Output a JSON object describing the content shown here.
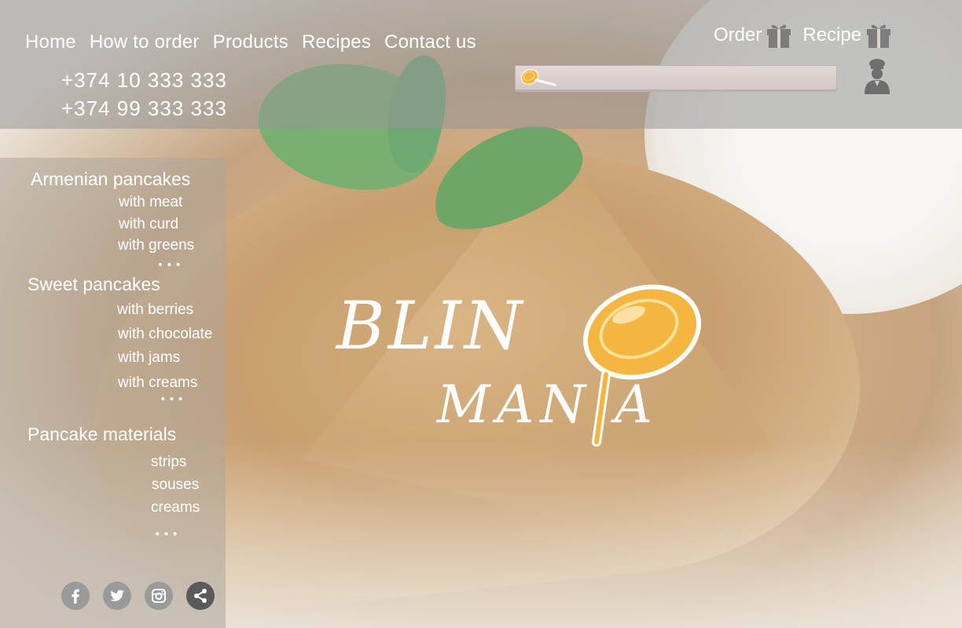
{
  "nav": {
    "items": [
      {
        "label": "Home"
      },
      {
        "label": "How to order"
      },
      {
        "label": "Products"
      },
      {
        "label": "Recipes"
      },
      {
        "label": "Contact us"
      }
    ]
  },
  "phones": [
    "+374 10 333 333",
    "+374 99 333 333"
  ],
  "header_actions": {
    "order_label": "Order",
    "recipe_label": "Recipe"
  },
  "search": {
    "value": "",
    "icon": "frying-pan-icon"
  },
  "sidebar": {
    "categories": [
      {
        "title": "Armenian pancakes",
        "items": [
          "with meat",
          "with curd",
          "with greens"
        ],
        "more": "•••"
      },
      {
        "title": "Sweet pancakes",
        "items": [
          "with berries",
          "with chocolate",
          "with jams",
          "with creams"
        ],
        "more": "•••"
      },
      {
        "title": "Pancake materials",
        "items": [
          "strips",
          "souses",
          "creams"
        ],
        "more": "•••"
      }
    ],
    "social": [
      "facebook-icon",
      "twitter-icon",
      "instagram-icon",
      "share-icon"
    ]
  },
  "logo": {
    "line1": "BLIN",
    "line2": "MAN A"
  },
  "colors": {
    "accent": "#f4b640",
    "overlay": "#969696",
    "text": "#ffffff"
  }
}
